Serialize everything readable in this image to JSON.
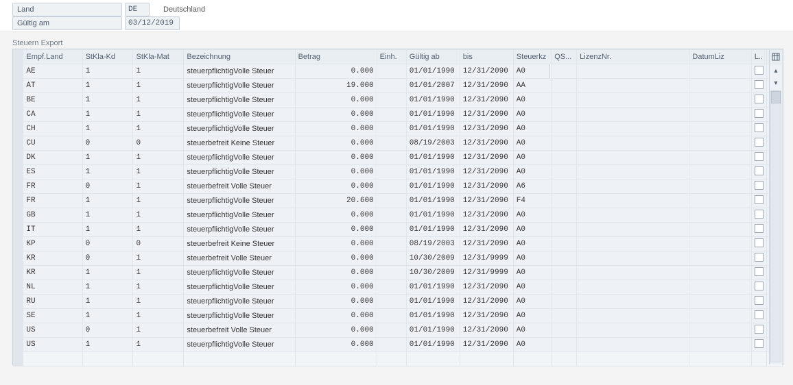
{
  "header": {
    "land_label": "Land",
    "land_value": "DE",
    "country_text": "Deutschland",
    "gueltig_label": "Gültig am",
    "gueltig_value": "03/12/2019"
  },
  "table": {
    "title": "Steuern Export",
    "columns": {
      "empf_land": "Empf.Land",
      "stkla_kd": "StKla-Kd",
      "stkla_mat": "StKla-Mat",
      "bezeichnung": "Bezeichnung",
      "betrag": "Betrag",
      "einh": "Einh.",
      "gueltig_ab": "Gültig ab",
      "bis": "bis",
      "steuerkz": "Steuerkz",
      "qs": "QS...",
      "lizenznr": "LizenzNr.",
      "datumliz": "DatumLiz",
      "l": "L.."
    },
    "rows": [
      {
        "land": "AE",
        "kd": "1",
        "mat": "1",
        "bez": "steuerpflichtigVolle Steuer",
        "betrag": "0.000",
        "einh": "",
        "ab": "01/01/1990",
        "bis": "12/31/2090",
        "kz": "A0",
        "f4": true
      },
      {
        "land": "AT",
        "kd": "1",
        "mat": "1",
        "bez": "steuerpflichtigVolle Steuer",
        "betrag": "19.000",
        "einh": "",
        "ab": "01/01/2007",
        "bis": "12/31/2090",
        "kz": "AA"
      },
      {
        "land": "BE",
        "kd": "1",
        "mat": "1",
        "bez": "steuerpflichtigVolle Steuer",
        "betrag": "0.000",
        "einh": "",
        "ab": "01/01/1990",
        "bis": "12/31/2090",
        "kz": "A0"
      },
      {
        "land": "CA",
        "kd": "1",
        "mat": "1",
        "bez": "steuerpflichtigVolle Steuer",
        "betrag": "0.000",
        "einh": "",
        "ab": "01/01/1990",
        "bis": "12/31/2090",
        "kz": "A0"
      },
      {
        "land": "CH",
        "kd": "1",
        "mat": "1",
        "bez": "steuerpflichtigVolle Steuer",
        "betrag": "0.000",
        "einh": "",
        "ab": "01/01/1990",
        "bis": "12/31/2090",
        "kz": "A0"
      },
      {
        "land": "CU",
        "kd": "0",
        "mat": "0",
        "bez": "steuerbefreit  Keine Steuer",
        "betrag": "0.000",
        "einh": "",
        "ab": "08/19/2003",
        "bis": "12/31/2090",
        "kz": "A0"
      },
      {
        "land": "DK",
        "kd": "1",
        "mat": "1",
        "bez": "steuerpflichtigVolle Steuer",
        "betrag": "0.000",
        "einh": "",
        "ab": "01/01/1990",
        "bis": "12/31/2090",
        "kz": "A0"
      },
      {
        "land": "ES",
        "kd": "1",
        "mat": "1",
        "bez": "steuerpflichtigVolle Steuer",
        "betrag": "0.000",
        "einh": "",
        "ab": "01/01/1990",
        "bis": "12/31/2090",
        "kz": "A0"
      },
      {
        "land": "FR",
        "kd": "0",
        "mat": "1",
        "bez": "steuerbefreit  Volle Steuer",
        "betrag": "0.000",
        "einh": "",
        "ab": "01/01/1990",
        "bis": "12/31/2090",
        "kz": "A6"
      },
      {
        "land": "FR",
        "kd": "1",
        "mat": "1",
        "bez": "steuerpflichtigVolle Steuer",
        "betrag": "20.600",
        "einh": "",
        "ab": "01/01/1990",
        "bis": "12/31/2090",
        "kz": "F4"
      },
      {
        "land": "GB",
        "kd": "1",
        "mat": "1",
        "bez": "steuerpflichtigVolle Steuer",
        "betrag": "0.000",
        "einh": "",
        "ab": "01/01/1990",
        "bis": "12/31/2090",
        "kz": "A0"
      },
      {
        "land": "IT",
        "kd": "1",
        "mat": "1",
        "bez": "steuerpflichtigVolle Steuer",
        "betrag": "0.000",
        "einh": "",
        "ab": "01/01/1990",
        "bis": "12/31/2090",
        "kz": "A0"
      },
      {
        "land": "KP",
        "kd": "0",
        "mat": "0",
        "bez": "steuerbefreit  Keine Steuer",
        "betrag": "0.000",
        "einh": "",
        "ab": "08/19/2003",
        "bis": "12/31/2090",
        "kz": "A0"
      },
      {
        "land": "KR",
        "kd": "0",
        "mat": "1",
        "bez": "steuerbefreit  Volle Steuer",
        "betrag": "0.000",
        "einh": "",
        "ab": "10/30/2009",
        "bis": "12/31/9999",
        "kz": "A0"
      },
      {
        "land": "KR",
        "kd": "1",
        "mat": "1",
        "bez": "steuerpflichtigVolle Steuer",
        "betrag": "0.000",
        "einh": "",
        "ab": "10/30/2009",
        "bis": "12/31/9999",
        "kz": "A0"
      },
      {
        "land": "NL",
        "kd": "1",
        "mat": "1",
        "bez": "steuerpflichtigVolle Steuer",
        "betrag": "0.000",
        "einh": "",
        "ab": "01/01/1990",
        "bis": "12/31/2090",
        "kz": "A0"
      },
      {
        "land": "RU",
        "kd": "1",
        "mat": "1",
        "bez": "steuerpflichtigVolle Steuer",
        "betrag": "0.000",
        "einh": "",
        "ab": "01/01/1990",
        "bis": "12/31/2090",
        "kz": "A0"
      },
      {
        "land": "SE",
        "kd": "1",
        "mat": "1",
        "bez": "steuerpflichtigVolle Steuer",
        "betrag": "0.000",
        "einh": "",
        "ab": "01/01/1990",
        "bis": "12/31/2090",
        "kz": "A0"
      },
      {
        "land": "US",
        "kd": "0",
        "mat": "1",
        "bez": "steuerbefreit  Volle Steuer",
        "betrag": "0.000",
        "einh": "",
        "ab": "01/01/1990",
        "bis": "12/31/2090",
        "kz": "A0"
      },
      {
        "land": "US",
        "kd": "1",
        "mat": "1",
        "bez": "steuerpflichtigVolle Steuer",
        "betrag": "0.000",
        "einh": "",
        "ab": "01/01/1990",
        "bis": "12/31/2090",
        "kz": "A0"
      }
    ]
  }
}
